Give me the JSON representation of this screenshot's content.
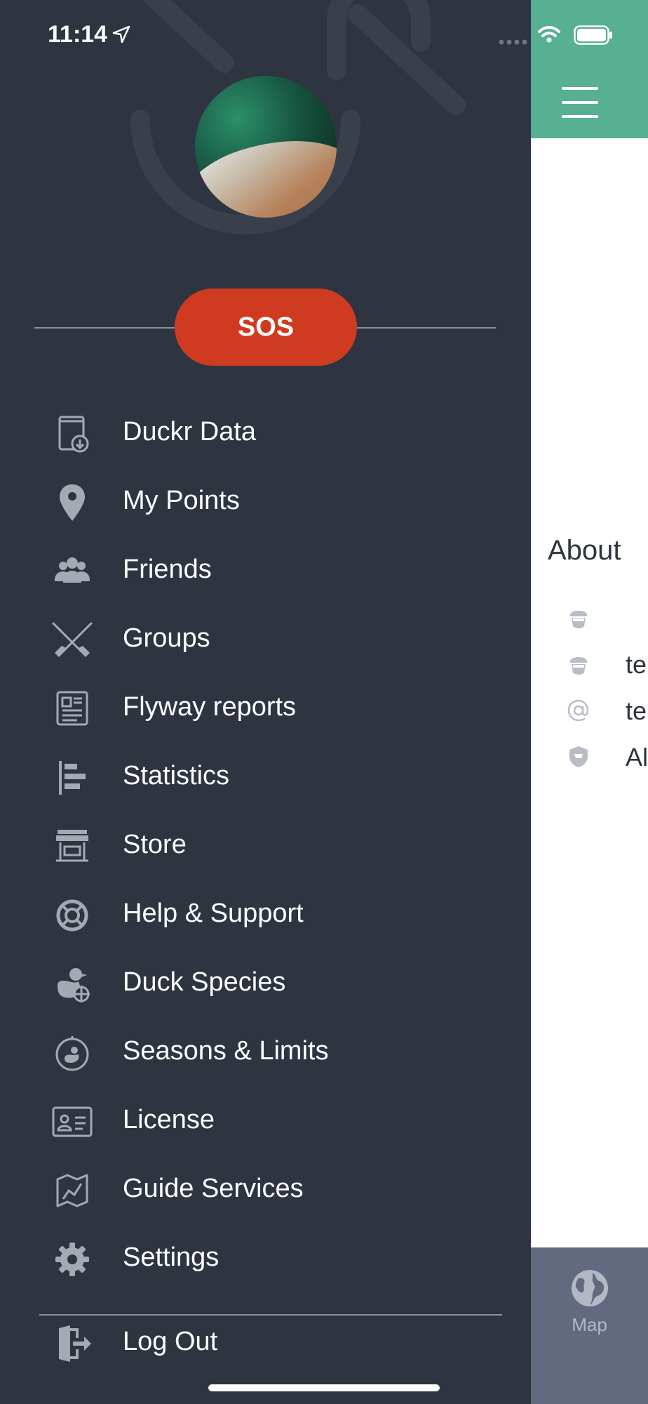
{
  "status_bar": {
    "time": "11:14"
  },
  "drawer": {
    "sos_label": "SOS",
    "menu": [
      {
        "label": "Duckr Data",
        "icon": "download-book-icon"
      },
      {
        "label": "My Points",
        "icon": "map-pin-icon"
      },
      {
        "label": "Friends",
        "icon": "friends-icon"
      },
      {
        "label": "Groups",
        "icon": "crossed-shotguns-icon"
      },
      {
        "label": "Flyway reports",
        "icon": "newspaper-icon"
      },
      {
        "label": "Statistics",
        "icon": "bar-chart-icon"
      },
      {
        "label": "Store",
        "icon": "store-icon"
      },
      {
        "label": "Help & Support",
        "icon": "lifebuoy-icon"
      },
      {
        "label": "Duck Species",
        "icon": "duck-target-icon"
      },
      {
        "label": "Seasons & Limits",
        "icon": "duck-timer-icon"
      },
      {
        "label": "License",
        "icon": "id-card-icon"
      },
      {
        "label": "Guide Services",
        "icon": "map-route-icon"
      },
      {
        "label": "Settings",
        "icon": "gear-icon"
      }
    ],
    "logout_label": "Log Out"
  },
  "main": {
    "about_title": "About",
    "about_rows": [
      {
        "icon": "hunter-icon",
        "text": ""
      },
      {
        "icon": "hunter-icon",
        "text": "te"
      },
      {
        "icon": "at-icon",
        "text": "te"
      },
      {
        "icon": "shield-icon",
        "text": "Al"
      }
    ],
    "tab_map_label": "Map"
  },
  "colors": {
    "drawer_bg": "#2e3541",
    "header_green": "#56b091",
    "sos_red": "#cf3b20",
    "icon_gray": "#a4a9b3",
    "tabbar_bg": "#636a7f"
  }
}
